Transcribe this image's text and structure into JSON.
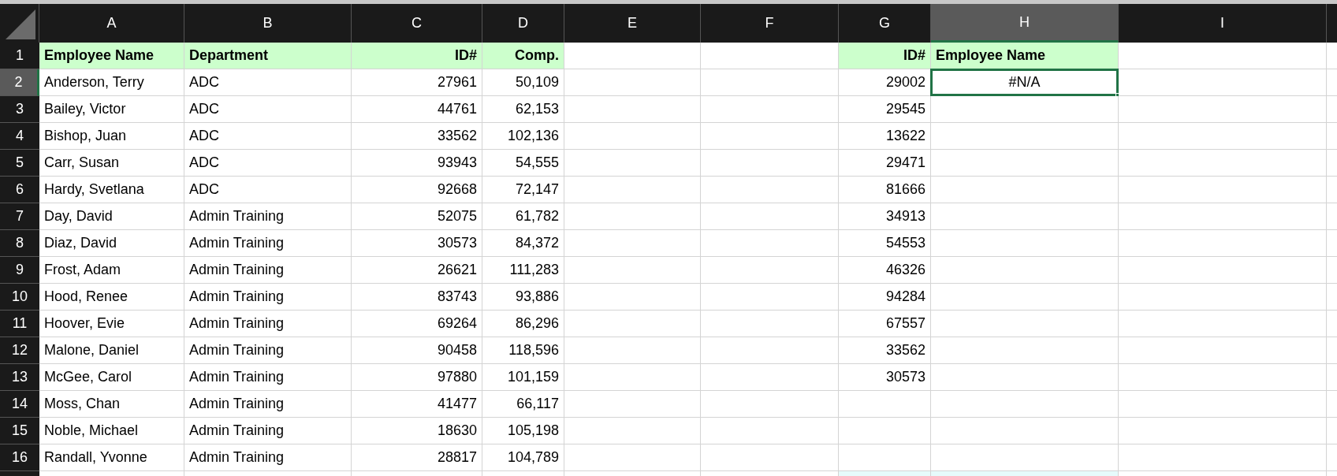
{
  "columns": [
    {
      "letter": "A",
      "selected": false,
      "right_aligned": false
    },
    {
      "letter": "B",
      "selected": false,
      "right_aligned": false
    },
    {
      "letter": "C",
      "selected": false,
      "right_aligned": true
    },
    {
      "letter": "D",
      "selected": false,
      "right_aligned": true
    },
    {
      "letter": "E",
      "selected": false
    },
    {
      "letter": "F",
      "selected": false
    },
    {
      "letter": "G",
      "selected": false,
      "right_aligned": true
    },
    {
      "letter": "H",
      "selected": true,
      "right_aligned": false
    },
    {
      "letter": "I",
      "selected": false
    }
  ],
  "rows": [
    {
      "number": "1",
      "kind": "header",
      "selected": false,
      "cells": {
        "A": "Employee Name",
        "B": "Department",
        "C": "ID#",
        "D": "Comp.",
        "G": "ID#",
        "H": "Employee Name"
      }
    },
    {
      "number": "2",
      "kind": "data",
      "selected": true,
      "cells": {
        "A": "Anderson, Terry",
        "B": "ADC",
        "C": "27961",
        "D": "50,109",
        "G": "29002",
        "H": {
          "text": "#N/A",
          "kind": "error"
        }
      }
    },
    {
      "number": "3",
      "kind": "data",
      "selected": false,
      "cells": {
        "A": "Bailey, Victor",
        "B": "ADC",
        "C": "44761",
        "D": "62,153",
        "G": "29545"
      }
    },
    {
      "number": "4",
      "kind": "data",
      "selected": false,
      "cells": {
        "A": "Bishop, Juan",
        "B": "ADC",
        "C": "33562",
        "D": "102,136",
        "G": "13622"
      }
    },
    {
      "number": "5",
      "kind": "data",
      "selected": false,
      "cells": {
        "A": "Carr, Susan",
        "B": "ADC",
        "C": "93943",
        "D": "54,555",
        "G": "29471"
      }
    },
    {
      "number": "6",
      "kind": "data",
      "selected": false,
      "cells": {
        "A": "Hardy, Svetlana",
        "B": "ADC",
        "C": "92668",
        "D": "72,147",
        "G": "81666"
      }
    },
    {
      "number": "7",
      "kind": "data",
      "selected": false,
      "cells": {
        "A": "Day, David",
        "B": "Admin Training",
        "C": "52075",
        "D": "61,782",
        "G": "34913"
      }
    },
    {
      "number": "8",
      "kind": "data",
      "selected": false,
      "cells": {
        "A": "Diaz, David",
        "B": "Admin Training",
        "C": "30573",
        "D": "84,372",
        "G": "54553"
      }
    },
    {
      "number": "9",
      "kind": "data",
      "selected": false,
      "cells": {
        "A": "Frost, Adam",
        "B": "Admin Training",
        "C": "26621",
        "D": "111,283",
        "G": "46326"
      }
    },
    {
      "number": "10",
      "kind": "data",
      "selected": false,
      "cells": {
        "A": "Hood, Renee",
        "B": "Admin Training",
        "C": "83743",
        "D": "93,886",
        "G": "94284"
      }
    },
    {
      "number": "11",
      "kind": "data",
      "selected": false,
      "cells": {
        "A": "Hoover, Evie",
        "B": "Admin Training",
        "C": "69264",
        "D": "86,296",
        "G": "67557"
      }
    },
    {
      "number": "12",
      "kind": "data",
      "selected": false,
      "cells": {
        "A": "Malone, Daniel",
        "B": "Admin Training",
        "C": "90458",
        "D": "118,596",
        "G": "33562"
      }
    },
    {
      "number": "13",
      "kind": "data",
      "selected": false,
      "cells": {
        "A": "McGee, Carol",
        "B": "Admin Training",
        "C": "97880",
        "D": "101,159",
        "G": "30573"
      }
    },
    {
      "number": "14",
      "kind": "data",
      "selected": false,
      "cells": {
        "A": "Moss, Chan",
        "B": "Admin Training",
        "C": "41477",
        "D": "66,117"
      }
    },
    {
      "number": "15",
      "kind": "data",
      "selected": false,
      "cells": {
        "A": "Noble, Michael",
        "B": "Admin Training",
        "C": "18630",
        "D": "105,198"
      }
    },
    {
      "number": "16",
      "kind": "data",
      "selected": false,
      "cells": {
        "A": "Randall, Yvonne",
        "B": "Admin Training",
        "C": "28817",
        "D": "104,789"
      }
    },
    {
      "kind": "cutoff",
      "selected": false,
      "cells": {
        "G": {
          "kind": "tinted"
        },
        "H": {
          "kind": "tinted"
        }
      }
    }
  ]
}
